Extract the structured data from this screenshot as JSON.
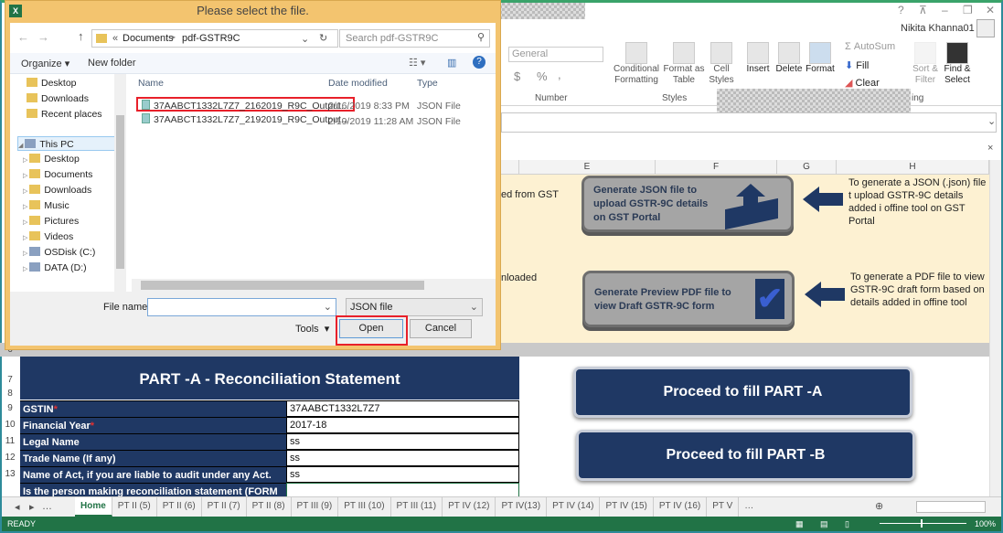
{
  "excel": {
    "title_fragment": "el",
    "user": "Nikita Khanna01",
    "ribbon": {
      "number_format": "General",
      "number_group": "Number",
      "styles_group": "Styles",
      "editing_group_fragment": "ing",
      "conditional_formatting": [
        "Conditional",
        "Formatting"
      ],
      "format_as_table": [
        "Format as",
        "Table"
      ],
      "cell_styles": [
        "Cell",
        "Styles"
      ],
      "insert": "Insert",
      "delete": "Delete",
      "format": "Format",
      "autosum": "AutoSum",
      "fill": "Fill",
      "clear": "Clear",
      "sort_filter": [
        "Sort &",
        "Filter"
      ],
      "find_select": [
        "Find &",
        "Select"
      ],
      "currency": "$",
      "percent": "%",
      "comma": ","
    },
    "columns": [
      "E",
      "F",
      "G",
      "H"
    ],
    "left_text_1": "ed from GST",
    "left_text_2": "nloaded",
    "gen_json_btn": "Generate JSON file to upload GSTR-9C details on GST Portal",
    "gen_json_note": "To generate a JSON (.json) file t upload GSTR-9C details added i offine tool on GST Portal",
    "gen_pdf_btn": "Generate Preview PDF file to view Draft GSTR-9C form",
    "gen_pdf_note": "To generate a PDF file to view GSTR-9C draft form based on details added in offine tool",
    "part_a_title": "PART -A - Reconciliation Statement",
    "rows": [
      {
        "num": "9",
        "label": "GSTIN",
        "required": true,
        "value": "37AABCT1332L7Z7"
      },
      {
        "num": "10",
        "label": "Financial Year",
        "required": true,
        "value": "2017-18"
      },
      {
        "num": "11",
        "label": "Legal Name",
        "required": false,
        "value": "ss"
      },
      {
        "num": "12",
        "label": "Trade Name (If any)",
        "required": false,
        "value": "ss"
      },
      {
        "num": "13",
        "label": "Name of Act, if you are liable to audit under any Act.",
        "required": false,
        "value": "ss"
      },
      {
        "num": "",
        "label": "Is the person making reconciliation statement (FORM",
        "required": false,
        "value": ""
      }
    ],
    "row_nums": {
      "r6": "6",
      "r7": "7",
      "r8": "8"
    },
    "proceed_a": "Proceed to fill PART -A",
    "proceed_b": "Proceed to fill PART -B",
    "sheet_tabs": [
      "Home",
      "PT II (5)",
      "PT II (6)",
      "PT II (7)",
      "PT II (8)",
      "PT III (9)",
      "PT III (10)",
      "PT III (11)",
      "PT IV (12)",
      "PT IV(13)",
      "PT IV (14)",
      "PT IV (15)",
      "PT IV (16)",
      "PT V"
    ],
    "active_tab": "Home",
    "status": "READY",
    "zoom": "100%",
    "colors": {
      "green": "#217346",
      "navy": "#1f3864",
      "cream": "#fdf1d2"
    }
  },
  "dialog": {
    "title": "Please select the file.",
    "breadcrumb": [
      "Documents",
      "pdf-GSTR9C"
    ],
    "search_placeholder": "Search pdf-GSTR9C",
    "organize": "Organize",
    "new_folder": "New folder",
    "nav": [
      "Desktop",
      "Downloads",
      "Recent places",
      "This PC",
      "Desktop",
      "Documents",
      "Downloads",
      "Music",
      "Pictures",
      "Videos",
      "OSDisk (C:)",
      "DATA (D:)"
    ],
    "columns": {
      "name": "Name",
      "date": "Date modified",
      "type": "Type"
    },
    "files": [
      {
        "name": "37AABCT1332L7Z7_2162019_R9C_Output...",
        "date": "2/16/2019 8:33 PM",
        "type": "JSON File",
        "highlighted": true
      },
      {
        "name": "37AABCT1332L7Z7_2192019_R9C_Output...",
        "date": "2/19/2019 11:28 AM",
        "type": "JSON File",
        "highlighted": false
      }
    ],
    "file_name_label": "File name:",
    "file_name_value": "",
    "filter": "JSON file",
    "tools": "Tools",
    "open": "Open",
    "cancel": "Cancel",
    "highlight_color": "#e8202a"
  }
}
